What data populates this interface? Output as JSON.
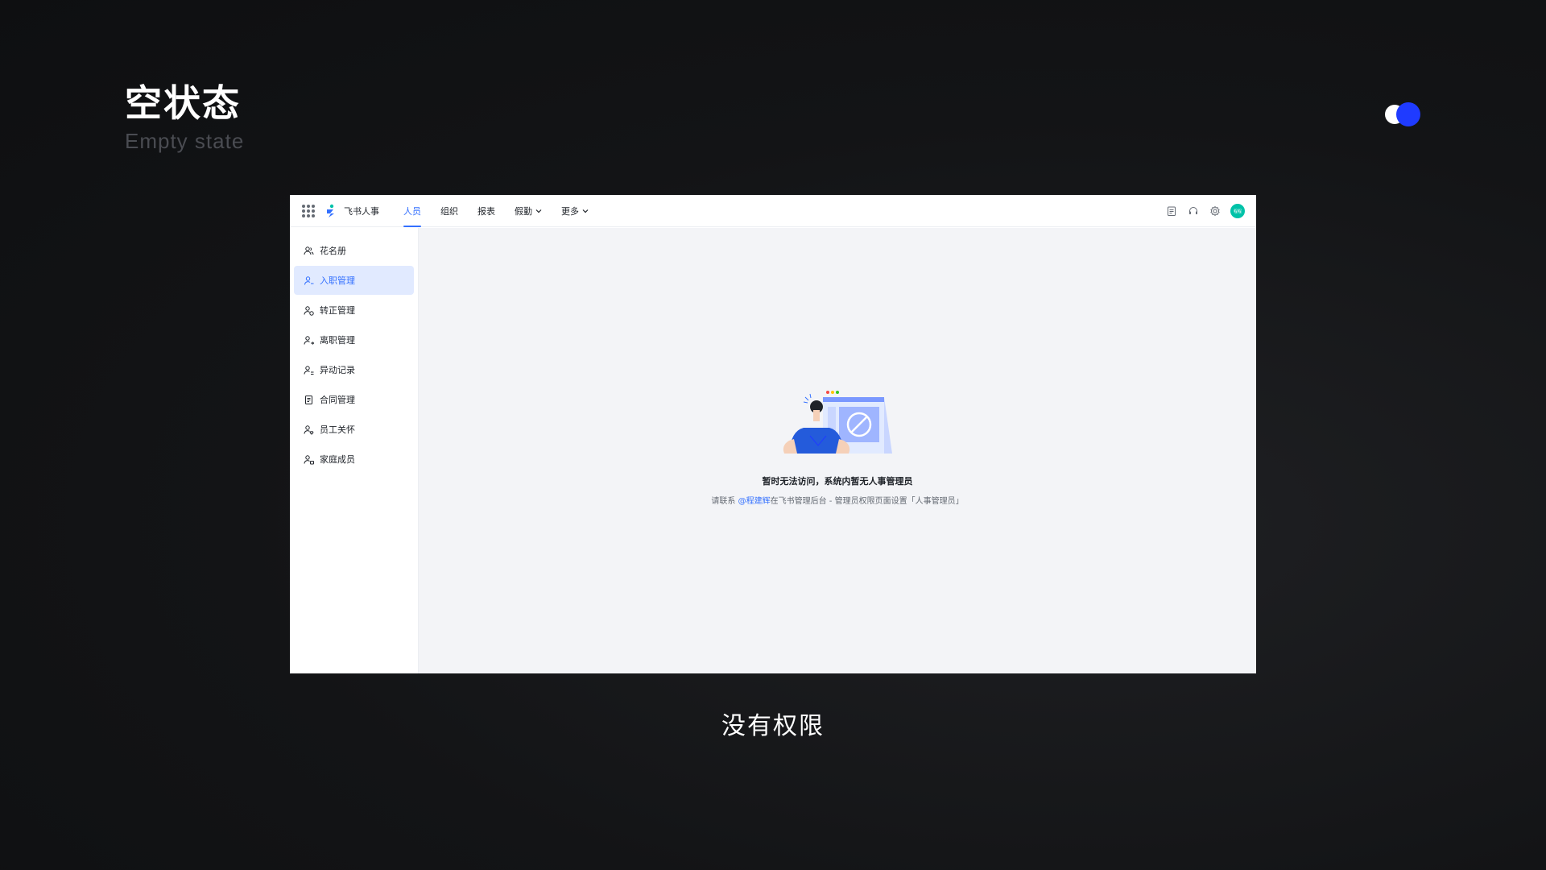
{
  "slide": {
    "title": "空状态",
    "subtitle": "Empty state",
    "caption": "没有权限"
  },
  "app": {
    "name": "飞书人事",
    "nav": [
      {
        "label": "人员",
        "active": true
      },
      {
        "label": "组织"
      },
      {
        "label": "报表"
      },
      {
        "label": "假勤",
        "dropdown": true
      },
      {
        "label": "更多",
        "dropdown": true
      }
    ],
    "top_icons": [
      "clipboard-icon",
      "headset-icon",
      "gear-icon"
    ],
    "avatar_text": "程程",
    "sidebar": [
      {
        "label": "花名册",
        "icon": "users-icon"
      },
      {
        "label": "入职管理",
        "icon": "user-add-icon",
        "active": true
      },
      {
        "label": "转正管理",
        "icon": "user-check-icon"
      },
      {
        "label": "离职管理",
        "icon": "user-leave-icon"
      },
      {
        "label": "异动记录",
        "icon": "user-transfer-icon"
      },
      {
        "label": "合同管理",
        "icon": "document-icon"
      },
      {
        "label": "员工关怀",
        "icon": "user-care-icon"
      },
      {
        "label": "家庭成员",
        "icon": "family-icon"
      }
    ],
    "empty_state": {
      "title": "暂时无法访问，系统内暂无人事管理员",
      "desc_prefix": "请联系 ",
      "mention": "@程建辉",
      "desc_suffix": "在飞书管理后台 - 管理员权限页面设置「人事管理员」"
    }
  },
  "colors": {
    "accent": "#3370ff",
    "toggle_blue": "#1f3bff",
    "avatar": "#00c2a8"
  }
}
